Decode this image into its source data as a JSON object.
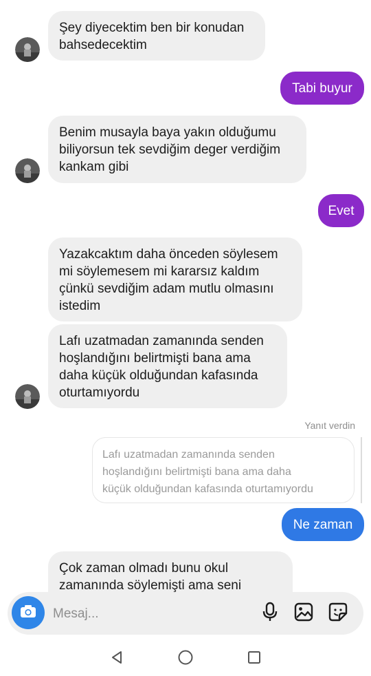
{
  "messages": [
    {
      "id": "m1",
      "direction": "incoming",
      "text": "Şey diyecektim ben bir konudan\nbahsedecektim"
    },
    {
      "id": "m2",
      "direction": "outgoing",
      "text": "Tabi buyur",
      "color": "#8b2ac9"
    },
    {
      "id": "m3",
      "direction": "incoming",
      "text": "Benim musayla baya yakın olduğumu\nbiliyorsun tek sevdiğim deger verdiğim\nkankam gibi"
    },
    {
      "id": "m4",
      "direction": "outgoing",
      "text": "Evet",
      "color": "#8b2ac9"
    },
    {
      "id": "m5",
      "direction": "incoming",
      "text": "Yazakcaktım daha önceden söylesem\nmi söylemesem mi kararsız kaldım\nçünkü sevdiğim adam mutlu olmasını\nistedim"
    },
    {
      "id": "m6",
      "direction": "incoming",
      "text": "Lafı uzatmadan zamanında senden\nhoşlandığını belirtmişti bana ama\ndaha küçük olduğundan kafasında\noturtamıyordu"
    },
    {
      "id": "m7",
      "direction": "outgoing",
      "text": "Ne zaman",
      "color": "#2f79e5"
    },
    {
      "id": "m8",
      "direction": "incoming",
      "text": "Çok zaman olmadı bunu okul\nzamanında söylemişti ama seni"
    }
  ],
  "reply": {
    "label": "Yanıt verdin",
    "quoted_text": "Lafı uzatmadan zamanında senden\nhoşlandığını belirtmişti bana ama daha\nküçük olduğundan kafasında oturtamıyordu"
  },
  "composer": {
    "placeholder": "Mesaj...",
    "icons": [
      "camera-icon",
      "microphone-icon",
      "gallery-icon",
      "sticker-icon"
    ],
    "camera_color": "#2f86e8"
  },
  "navbar": {
    "icons": [
      "back-triangle-icon",
      "home-circle-icon",
      "recents-square-icon"
    ]
  }
}
